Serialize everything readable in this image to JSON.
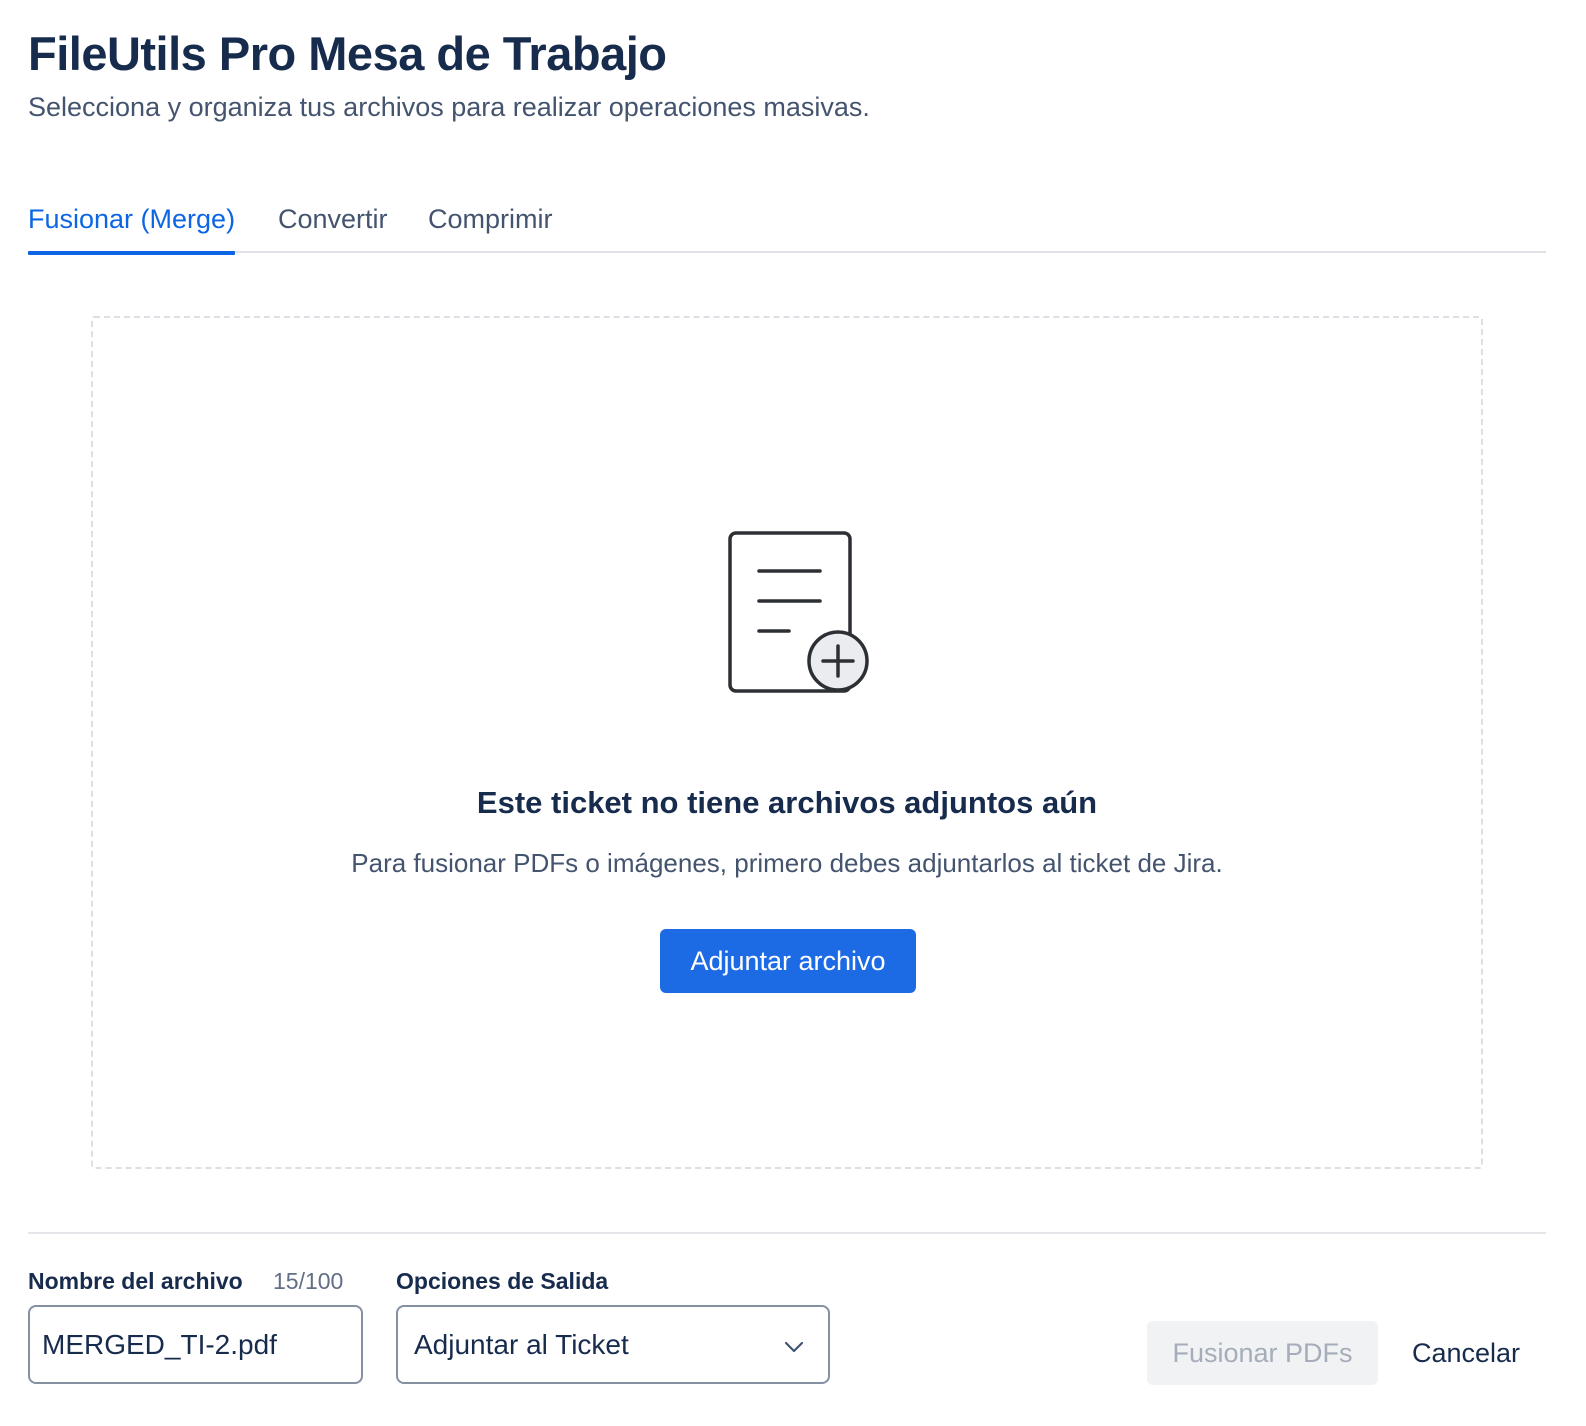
{
  "header": {
    "title": "FileUtils Pro Mesa de Trabajo",
    "subtitle": "Selecciona y organiza tus archivos para realizar operaciones masivas."
  },
  "tabs": [
    {
      "label": "Fusionar (Merge)",
      "active": true
    },
    {
      "label": "Convertir",
      "active": false
    },
    {
      "label": "Comprimir",
      "active": false
    }
  ],
  "empty_state": {
    "icon": "document-add-icon",
    "heading": "Este ticket no tiene archivos adjuntos aún",
    "description": "Para fusionar PDFs o imágenes, primero debes adjuntarlos al ticket de Jira.",
    "button_label": "Adjuntar archivo"
  },
  "footer": {
    "filename_label": "Nombre del archivo",
    "filename_counter": "15/100",
    "filename_value": "MERGED_TI-2.pdf",
    "output_label": "Opciones de Salida",
    "output_value": "Adjuntar al Ticket",
    "merge_button_label": "Fusionar PDFs",
    "merge_button_disabled": true,
    "cancel_button_label": "Cancelar"
  },
  "colors": {
    "accent": "#0c66e4",
    "primary_button": "#1d6ae5",
    "disabled_button_bg": "#f1f2f4",
    "disabled_button_text": "#a5adba",
    "text_primary": "#172b4d",
    "text_secondary": "#44546f"
  }
}
